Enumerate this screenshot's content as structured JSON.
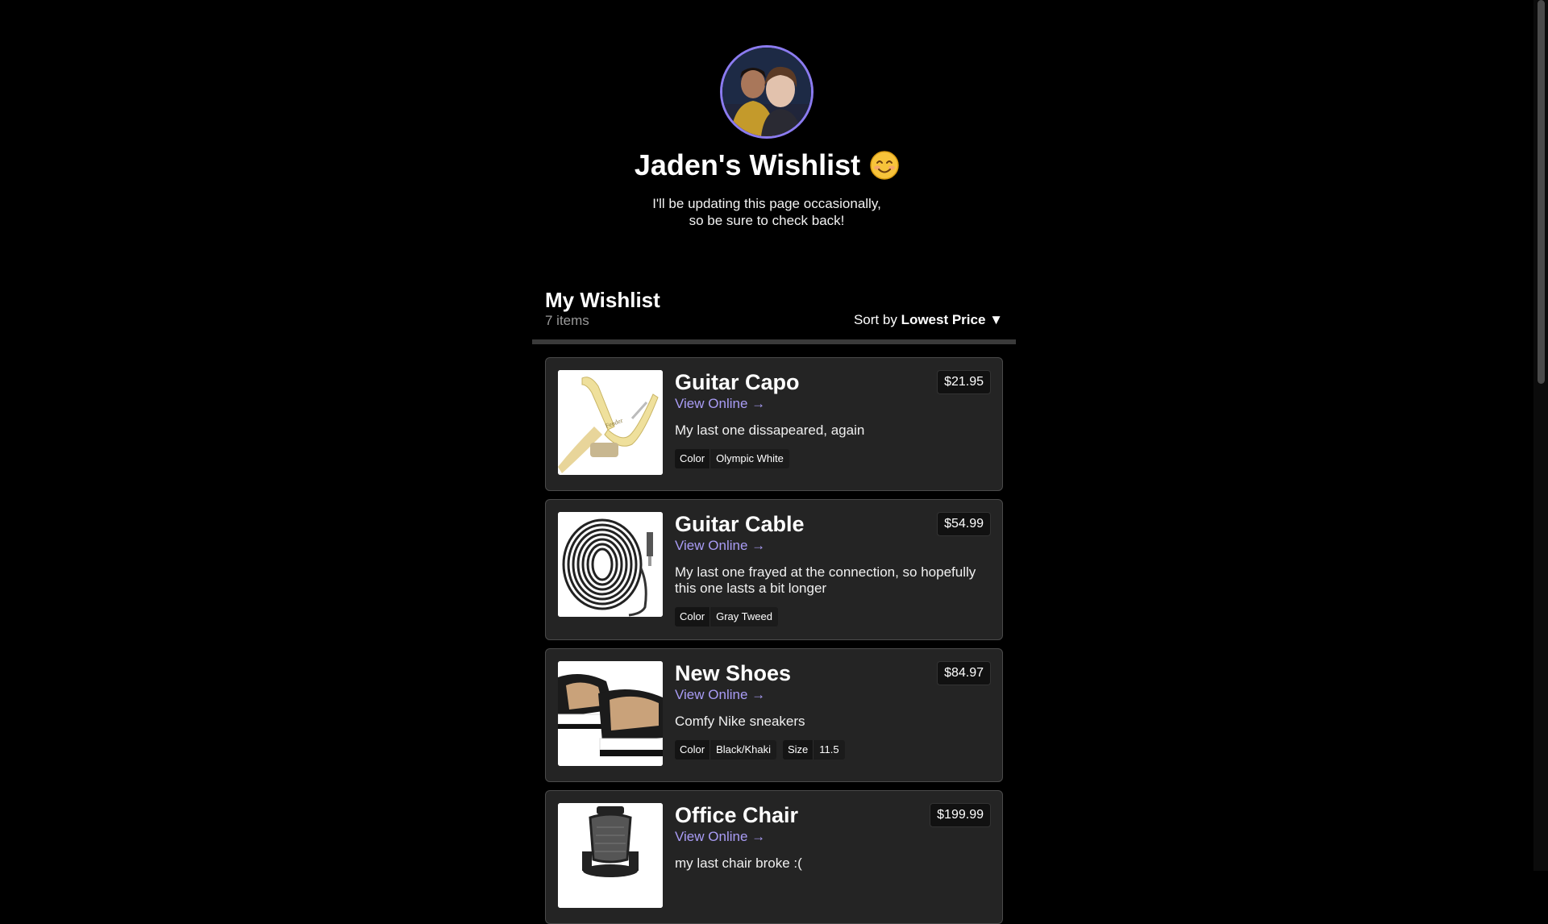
{
  "header": {
    "title": "Jaden's Wishlist",
    "subtitle_line1": "I'll be updating this page occasionally,",
    "subtitle_line2": "so be sure to check back!",
    "avatar_icon": "profile-photo-icon",
    "emoji_icon": "smiling-face-icon"
  },
  "wishlist": {
    "title": "My Wishlist",
    "count": "7 items",
    "sort_prefix": "Sort by",
    "sort_value": "Lowest Price",
    "sort_caret": "▼"
  },
  "items": [
    {
      "name": "Guitar Capo",
      "link": "View Online →",
      "price": "$21.95",
      "desc": "My last one dissapeared, again",
      "attrs": [
        {
          "k": "Color",
          "v": "Olympic White"
        }
      ],
      "icon": "guitar-capo-image"
    },
    {
      "name": "Guitar Cable",
      "link": "View Online →",
      "price": "$54.99",
      "desc_line1": "My last one frayed at the connection, so hopefully",
      "desc_line2": "this one lasts a bit longer",
      "attrs": [
        {
          "k": "Color",
          "v": "Gray Tweed"
        }
      ],
      "icon": "guitar-cable-image"
    },
    {
      "name": "New Shoes",
      "link": "View Online →",
      "price": "$84.97",
      "desc": "Comfy Nike sneakers",
      "attrs": [
        {
          "k": "Color",
          "v": "Black/Khaki"
        },
        {
          "k": "Size",
          "v": "11.5"
        }
      ],
      "icon": "sneakers-image"
    },
    {
      "name": "Office Chair",
      "link": "View Online →",
      "price": "$199.99",
      "desc": "my last chair broke :(",
      "icon": "office-chair-image"
    }
  ],
  "colors": {
    "background": "#000000",
    "card": "#242424",
    "accent_link": "#a99cf5",
    "avatar_ring": "#8b7bf0"
  }
}
